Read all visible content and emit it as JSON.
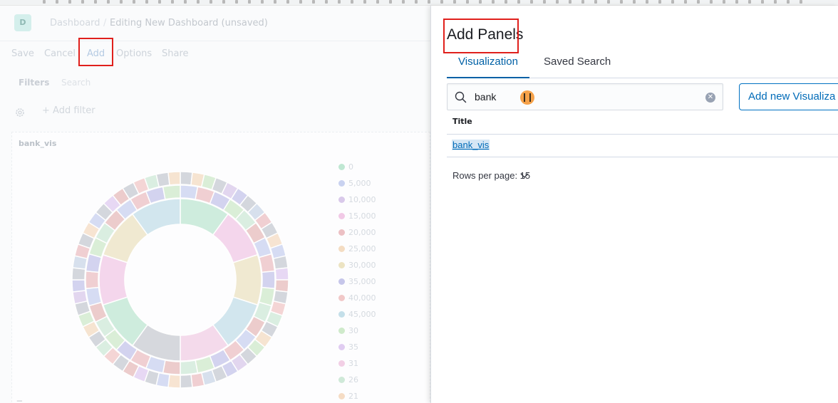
{
  "dashboard": {
    "logo_letter": "D",
    "breadcrumb_root": "Dashboard",
    "breadcrumb_current": "Editing New Dashboard (unsaved)",
    "menu": [
      {
        "label": "Save"
      },
      {
        "label": "Cancel"
      },
      {
        "label": "Add"
      },
      {
        "label": "Options"
      },
      {
        "label": "Share"
      }
    ],
    "filters_label": "Filters",
    "search_placeholder": "Search",
    "add_filter_label": "+ Add filter",
    "panel_title": "bank_vis",
    "legend": [
      {
        "label": "0",
        "color": "#bfe7d2"
      },
      {
        "label": "5,000",
        "color": "#c9d2f0"
      },
      {
        "label": "10,000",
        "color": "#d9c9ea"
      },
      {
        "label": "15,000",
        "color": "#f1c9e6"
      },
      {
        "label": "20,000",
        "color": "#ecc0c4"
      },
      {
        "label": "25,000",
        "color": "#f4dcc2"
      },
      {
        "label": "30,000",
        "color": "#ece3c2"
      },
      {
        "label": "35,000",
        "color": "#c6c6ea"
      },
      {
        "label": "40,000",
        "color": "#f1c8c8"
      },
      {
        "label": "45,000",
        "color": "#c4dfe9"
      },
      {
        "label": "30",
        "color": "#cfeacb"
      },
      {
        "label": "35",
        "color": "#e0ccf1"
      },
      {
        "label": "31",
        "color": "#f2cfe5"
      },
      {
        "label": "26",
        "color": "#cfe9d8"
      },
      {
        "label": "21",
        "color": "#f5dcc4"
      }
    ]
  },
  "flyout": {
    "title": "Add Panels",
    "tabs": [
      {
        "label": "Visualization",
        "active": true
      },
      {
        "label": "Saved Search",
        "active": false
      }
    ],
    "search_value": "bank",
    "add_new_button": "Add new Visualiza",
    "table": {
      "column_title": "Title",
      "rows": [
        {
          "title": "bank_vis"
        }
      ]
    },
    "rows_per_page": "Rows per page: 15"
  },
  "colors": {
    "accent": "#0061a6",
    "annotation_red": "#e0201c"
  }
}
